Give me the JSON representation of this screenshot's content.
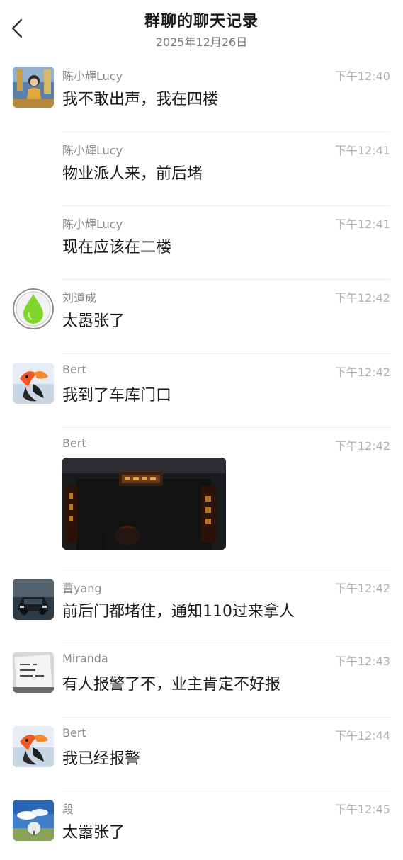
{
  "header": {
    "title": "群聊的聊天记录",
    "date": "2025年12月26日"
  },
  "messages": [
    {
      "sender": "陈小輝Lucy",
      "time": "下午12:40",
      "text": "我不敢出声，我在四楼",
      "avatar": "lucy-avatar"
    },
    {
      "sender": "陈小輝Lucy",
      "time": "下午12:41",
      "text": "物业派人来，前后堵"
    },
    {
      "sender": "陈小輝Lucy",
      "time": "下午12:41",
      "text": "现在应该在二楼"
    },
    {
      "sender": "刘道成",
      "time": "下午12:42",
      "text": "太嚣张了",
      "avatar": "green-drop-avatar"
    },
    {
      "sender": "Bert",
      "time": "下午12:42",
      "text": "我到了车库门口",
      "avatar": "goldfish-avatar"
    },
    {
      "sender": "Bert",
      "time": "下午12:42",
      "image": "night-gate-photo"
    },
    {
      "sender": "曹yang",
      "time": "下午12:42",
      "text": "前后门都堵住，通知110过来拿人",
      "avatar": "car-avatar"
    },
    {
      "sender": "Miranda",
      "time": "下午12:43",
      "text": "有人报警了不，业主肯定不好报",
      "avatar": "paper-avatar"
    },
    {
      "sender": "Bert",
      "time": "下午12:44",
      "text": "我已经报警",
      "avatar": "goldfish-avatar"
    },
    {
      "sender": "段",
      "time": "下午12:45",
      "text": "太嚣张了",
      "avatar": "sky-dome-avatar"
    }
  ]
}
